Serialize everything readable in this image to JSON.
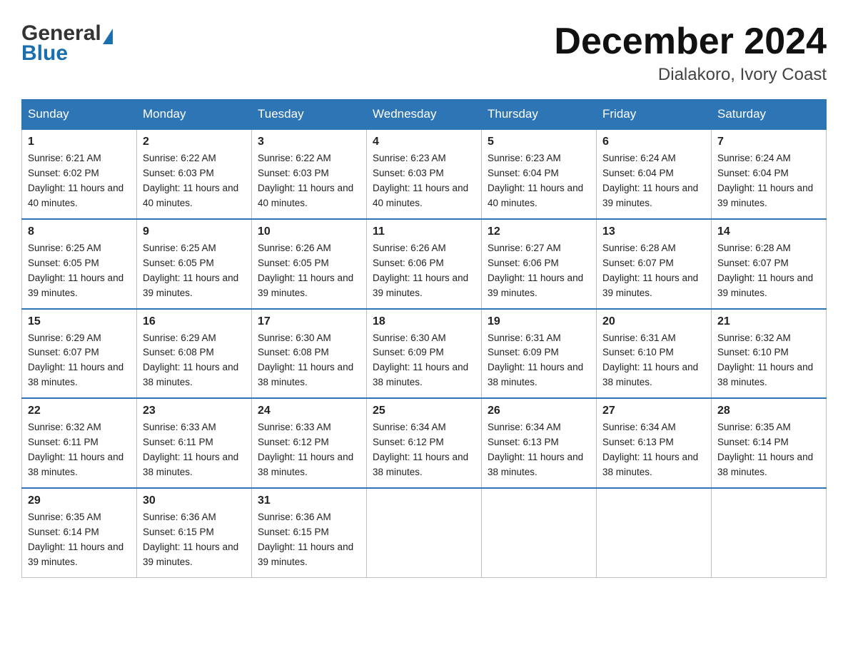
{
  "header": {
    "logo_general": "General",
    "logo_blue": "Blue",
    "month_title": "December 2024",
    "location": "Dialakoro, Ivory Coast"
  },
  "days_of_week": [
    "Sunday",
    "Monday",
    "Tuesday",
    "Wednesday",
    "Thursday",
    "Friday",
    "Saturday"
  ],
  "weeks": [
    [
      {
        "day": "1",
        "sunrise": "6:21 AM",
        "sunset": "6:02 PM",
        "daylight": "11 hours and 40 minutes."
      },
      {
        "day": "2",
        "sunrise": "6:22 AM",
        "sunset": "6:03 PM",
        "daylight": "11 hours and 40 minutes."
      },
      {
        "day": "3",
        "sunrise": "6:22 AM",
        "sunset": "6:03 PM",
        "daylight": "11 hours and 40 minutes."
      },
      {
        "day": "4",
        "sunrise": "6:23 AM",
        "sunset": "6:03 PM",
        "daylight": "11 hours and 40 minutes."
      },
      {
        "day": "5",
        "sunrise": "6:23 AM",
        "sunset": "6:04 PM",
        "daylight": "11 hours and 40 minutes."
      },
      {
        "day": "6",
        "sunrise": "6:24 AM",
        "sunset": "6:04 PM",
        "daylight": "11 hours and 39 minutes."
      },
      {
        "day": "7",
        "sunrise": "6:24 AM",
        "sunset": "6:04 PM",
        "daylight": "11 hours and 39 minutes."
      }
    ],
    [
      {
        "day": "8",
        "sunrise": "6:25 AM",
        "sunset": "6:05 PM",
        "daylight": "11 hours and 39 minutes."
      },
      {
        "day": "9",
        "sunrise": "6:25 AM",
        "sunset": "6:05 PM",
        "daylight": "11 hours and 39 minutes."
      },
      {
        "day": "10",
        "sunrise": "6:26 AM",
        "sunset": "6:05 PM",
        "daylight": "11 hours and 39 minutes."
      },
      {
        "day": "11",
        "sunrise": "6:26 AM",
        "sunset": "6:06 PM",
        "daylight": "11 hours and 39 minutes."
      },
      {
        "day": "12",
        "sunrise": "6:27 AM",
        "sunset": "6:06 PM",
        "daylight": "11 hours and 39 minutes."
      },
      {
        "day": "13",
        "sunrise": "6:28 AM",
        "sunset": "6:07 PM",
        "daylight": "11 hours and 39 minutes."
      },
      {
        "day": "14",
        "sunrise": "6:28 AM",
        "sunset": "6:07 PM",
        "daylight": "11 hours and 39 minutes."
      }
    ],
    [
      {
        "day": "15",
        "sunrise": "6:29 AM",
        "sunset": "6:07 PM",
        "daylight": "11 hours and 38 minutes."
      },
      {
        "day": "16",
        "sunrise": "6:29 AM",
        "sunset": "6:08 PM",
        "daylight": "11 hours and 38 minutes."
      },
      {
        "day": "17",
        "sunrise": "6:30 AM",
        "sunset": "6:08 PM",
        "daylight": "11 hours and 38 minutes."
      },
      {
        "day": "18",
        "sunrise": "6:30 AM",
        "sunset": "6:09 PM",
        "daylight": "11 hours and 38 minutes."
      },
      {
        "day": "19",
        "sunrise": "6:31 AM",
        "sunset": "6:09 PM",
        "daylight": "11 hours and 38 minutes."
      },
      {
        "day": "20",
        "sunrise": "6:31 AM",
        "sunset": "6:10 PM",
        "daylight": "11 hours and 38 minutes."
      },
      {
        "day": "21",
        "sunrise": "6:32 AM",
        "sunset": "6:10 PM",
        "daylight": "11 hours and 38 minutes."
      }
    ],
    [
      {
        "day": "22",
        "sunrise": "6:32 AM",
        "sunset": "6:11 PM",
        "daylight": "11 hours and 38 minutes."
      },
      {
        "day": "23",
        "sunrise": "6:33 AM",
        "sunset": "6:11 PM",
        "daylight": "11 hours and 38 minutes."
      },
      {
        "day": "24",
        "sunrise": "6:33 AM",
        "sunset": "6:12 PM",
        "daylight": "11 hours and 38 minutes."
      },
      {
        "day": "25",
        "sunrise": "6:34 AM",
        "sunset": "6:12 PM",
        "daylight": "11 hours and 38 minutes."
      },
      {
        "day": "26",
        "sunrise": "6:34 AM",
        "sunset": "6:13 PM",
        "daylight": "11 hours and 38 minutes."
      },
      {
        "day": "27",
        "sunrise": "6:34 AM",
        "sunset": "6:13 PM",
        "daylight": "11 hours and 38 minutes."
      },
      {
        "day": "28",
        "sunrise": "6:35 AM",
        "sunset": "6:14 PM",
        "daylight": "11 hours and 38 minutes."
      }
    ],
    [
      {
        "day": "29",
        "sunrise": "6:35 AM",
        "sunset": "6:14 PM",
        "daylight": "11 hours and 39 minutes."
      },
      {
        "day": "30",
        "sunrise": "6:36 AM",
        "sunset": "6:15 PM",
        "daylight": "11 hours and 39 minutes."
      },
      {
        "day": "31",
        "sunrise": "6:36 AM",
        "sunset": "6:15 PM",
        "daylight": "11 hours and 39 minutes."
      },
      null,
      null,
      null,
      null
    ]
  ]
}
